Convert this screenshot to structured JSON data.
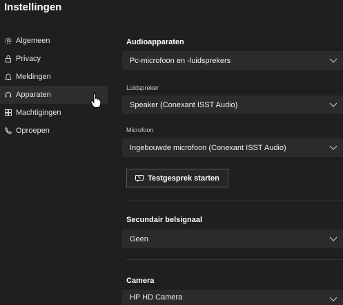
{
  "window": {
    "title": "Instellingen"
  },
  "sidebar": {
    "items": [
      {
        "label": "Algemeen",
        "icon": "gear-icon"
      },
      {
        "label": "Privacy",
        "icon": "lock-icon"
      },
      {
        "label": "Meldingen",
        "icon": "bell-icon"
      },
      {
        "label": "Apparaten",
        "icon": "headset-icon",
        "selected": true
      },
      {
        "label": "Machtigingen",
        "icon": "apps-grid-icon"
      },
      {
        "label": "Oproepen",
        "icon": "phone-icon"
      }
    ]
  },
  "audio": {
    "section_title": "Audioapparaten",
    "device_value": "Pc-microfoon en -luidsprekers",
    "speaker_label": "Luidspreker",
    "speaker_value": "Speaker (Conexant ISST Audio)",
    "mic_label": "Microfoon",
    "mic_value": "Ingebouwde microfoon (Conexant ISST Audio)",
    "test_button_label": "Testgesprek starten"
  },
  "ringtone": {
    "section_title": "Secundair belsignaal",
    "value": "Geen"
  },
  "camera": {
    "section_title": "Camera",
    "value": "HP HD Camera"
  },
  "colors": {
    "background": "#1f1f1f",
    "dropdown": "#2b2b2b",
    "selected_nav": "#2d2d2d"
  }
}
